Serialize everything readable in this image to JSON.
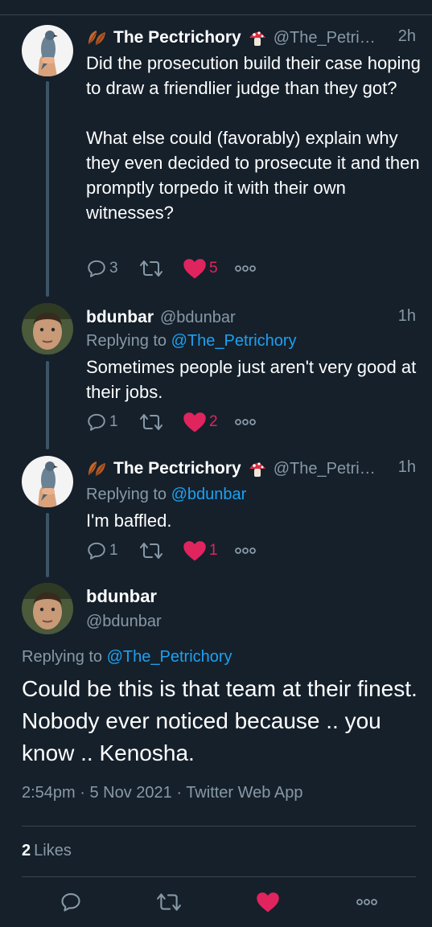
{
  "tweets": [
    {
      "name": "The Pectrichory",
      "handle": "@The_Petri…",
      "time": "2h",
      "replying_prefix": "",
      "replying_to": "",
      "text": "Did the prosecution build their case hoping to draw a friendlier judge than they got?\n\nWhat else could (favorably) explain why they even decided to prosecute it and then promptly torpedo it with their own witnesses?",
      "replies": "3",
      "retweets": "",
      "likes": "5"
    },
    {
      "name": "bdunbar",
      "handle": "@bdunbar",
      "time": "1h",
      "replying_prefix": "Replying to",
      "replying_to": "@The_Petrichory",
      "text": "Sometimes people just aren't very good at their jobs.",
      "replies": "1",
      "retweets": "",
      "likes": "2"
    },
    {
      "name": "The Pectrichory",
      "handle": "@The_Petri…",
      "time": "1h",
      "replying_prefix": "Replying to",
      "replying_to": "@bdunbar",
      "text": "I'm baffled.",
      "replies": "1",
      "retweets": "",
      "likes": "1"
    }
  ],
  "main_tweet": {
    "name": "bdunbar",
    "handle": "@bdunbar",
    "replying_prefix": "Replying to",
    "replying_to": "@The_Petrichory",
    "text": "Could be this is that team at their finest.  Nobody ever noticed because .. you know .. Kenosha.",
    "meta": "2:54pm · 5 Nov 2021 · Twitter Web App",
    "likes_count": "2",
    "likes_label": "Likes"
  },
  "colors": {
    "background": "#15202b",
    "secondary_text": "#8899a6",
    "link": "#1da1f2",
    "like": "#e0245e",
    "thread_line": "#3d5466"
  },
  "icons": {
    "reply": "reply-icon",
    "retweet": "retweet-icon",
    "like": "heart-icon",
    "more": "more-icon",
    "name_prefix": "leaves-emoji-icon",
    "name_suffix": "mushroom-emoji-icon"
  }
}
